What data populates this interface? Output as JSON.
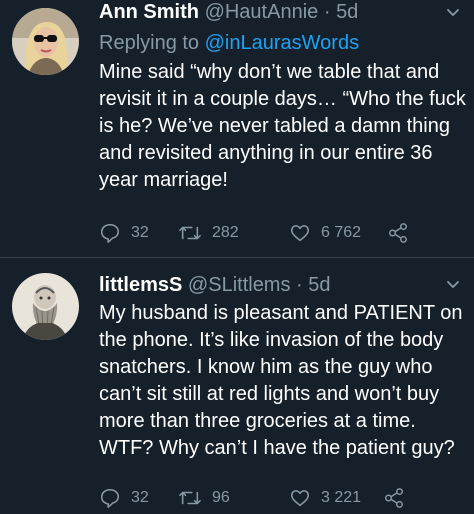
{
  "colors": {
    "background": "#15202b",
    "text": "#ffffff",
    "secondary": "#8899a6",
    "link": "#1da1f2",
    "divider": "#38444d"
  },
  "tweets": [
    {
      "name": "Ann Smith",
      "handle": "@HautAnnie",
      "separator": "·",
      "time": "5d",
      "reply_prefix": "Replying to",
      "reply_mention": "@inLaurasWords",
      "text": "Mine said “why don’t we table that and revisit it in a couple days… “Who the fuck is he? We’ve never tabled a damn thing and revisited anything in our entire 36 year marriage!",
      "replies": "32",
      "retweets": "282",
      "likes": "6 762",
      "avatar_icon": "profile-photo-woman-sunglasses"
    },
    {
      "name": "littlemsS",
      "handle": "@SLittlems",
      "separator": "·",
      "time": "5d",
      "text": "My husband is pleasant and PATIENT on the phone. It’s like invasion of the body snatchers. I know him as the guy who can’t sit still at red lights and won’t buy more than three groceries at a time. WTF? Why can’t I have the patient guy?",
      "replies": "32",
      "retweets": "96",
      "likes": "3 221",
      "avatar_icon": "profile-photo-bearded-man-sketch"
    }
  ]
}
